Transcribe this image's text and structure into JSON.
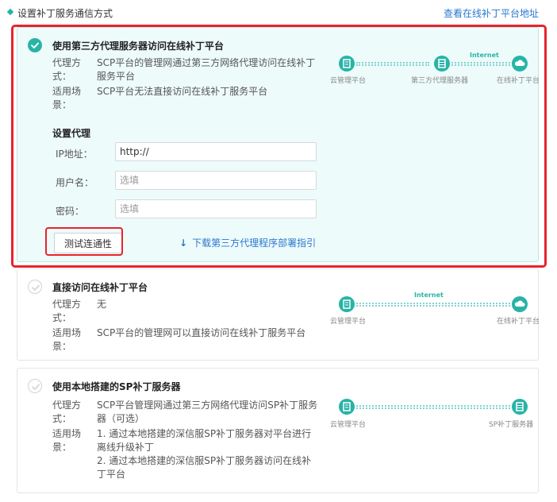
{
  "header": {
    "title": "设置补丁服务通信方式",
    "link_label": "查看在线补丁平台地址"
  },
  "options": [
    {
      "title": "使用第三方代理服务器访问在线补丁平台",
      "selected": true,
      "mode_label": [
        "代理方",
        "式："
      ],
      "mode_value": [
        "SCP平台的管理网通过第三方网络代理访问在线补丁",
        "服务平台"
      ],
      "scene_label": [
        "适用场",
        "景："
      ],
      "scene_value": [
        "SCP平台无法直接访问在线补丁服务平台"
      ],
      "diagram": {
        "internet_label": "Internet",
        "nodes": [
          "云管理平台",
          "第三方代理服务器",
          "在线补丁平台"
        ]
      },
      "proxy": {
        "section_title": "设置代理",
        "ip_label": "IP地址：",
        "ip_value": "http://",
        "user_label": "用户名：",
        "user_placeholder": "选填",
        "pwd_label": "密码：",
        "pwd_placeholder": "选填",
        "test_button": "测试连通性",
        "download_link": "下载第三方代理程序部署指引"
      }
    },
    {
      "title": "直接访问在线补丁平台",
      "selected": false,
      "mode_label": [
        "代理方",
        "式："
      ],
      "mode_value": [
        "无"
      ],
      "scene_label": [
        "适用场",
        "景："
      ],
      "scene_value": [
        "SCP平台的管理网可以直接访问在线补丁服务平台"
      ],
      "diagram": {
        "internet_label": "Internet",
        "nodes": [
          "云管理平台",
          "在线补丁平台"
        ]
      }
    },
    {
      "title": "使用本地搭建的SP补丁服务器",
      "selected": false,
      "mode_label": [
        "代理方",
        "式："
      ],
      "mode_value": [
        "SCP平台管理网通过第三方网络代理访问SP补丁服务",
        "器（可选）"
      ],
      "scene_label": [
        "适用场",
        "景："
      ],
      "scene_value": [
        "1. 通过本地搭建的深信服SP补丁服务器对平台进行",
        "离线升级补丁",
        "2. 通过本地搭建的深信服SP补丁服务器访问在线补",
        "丁平台"
      ],
      "diagram": {
        "nodes": [
          "云管理平台",
          "SP补丁服务器"
        ]
      }
    }
  ],
  "colors": {
    "accent": "#27b4a6",
    "link": "#2a77d1",
    "highlight": "#e8242a",
    "selected_bg": "#eefbfb"
  },
  "icons": [
    "check-circle-icon",
    "server-icon",
    "cloud-icon",
    "download-arrow-icon"
  ]
}
